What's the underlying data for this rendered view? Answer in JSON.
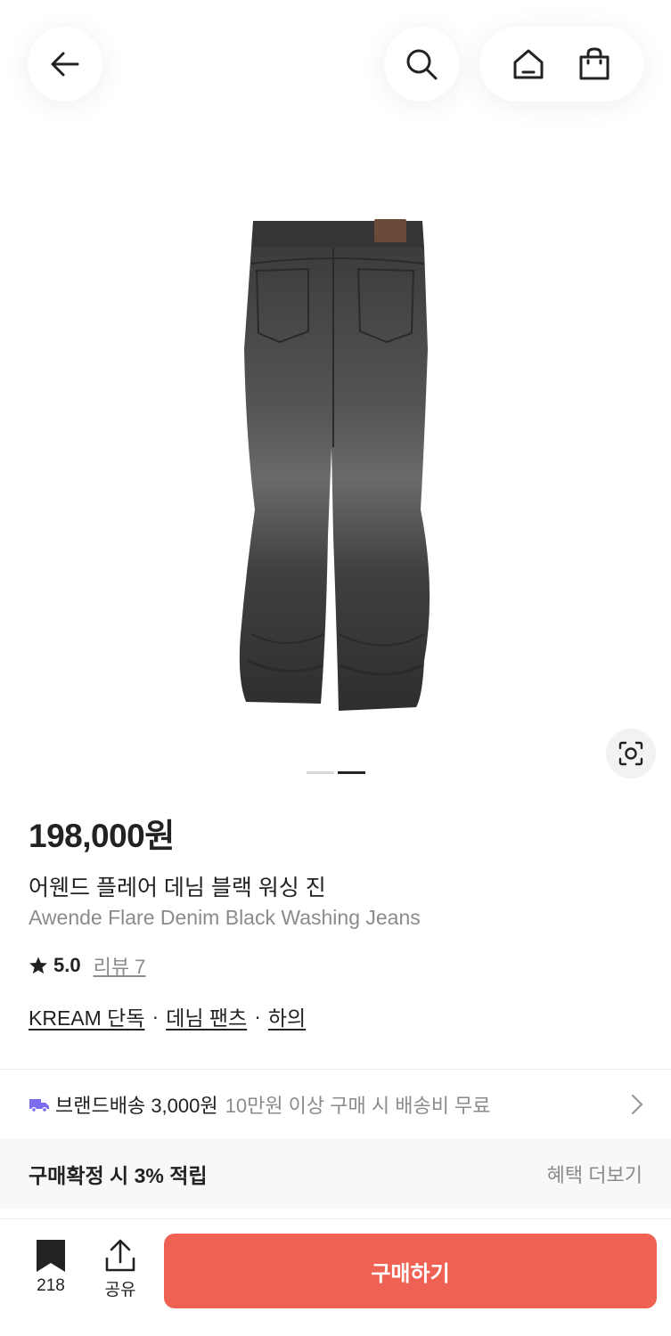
{
  "header": {
    "back_icon": "arrow-left-icon",
    "search_icon": "search-icon",
    "home_icon": "home-icon",
    "cart_icon": "shopping-bag-icon"
  },
  "gallery": {
    "image_icon": "jeans-product-image",
    "lens_icon": "lens-search-icon",
    "page_count": 2,
    "active_page": 2
  },
  "product": {
    "price": "198,000원",
    "name_ko": "어웬드 플레어 데님 블랙 워싱 진",
    "name_en": "Awende Flare Denim Black Washing Jeans",
    "rating": "5.0",
    "review_label": "리뷰 7",
    "tags": [
      "KREAM 단독",
      "데님 팬츠",
      "하의"
    ],
    "tag_separator": "·"
  },
  "shipping": {
    "label": "브랜드배송 3,000원",
    "note": "10만원 이상 구매 시 배송비 무료",
    "icon_color": "#7b6cf0"
  },
  "benefit": {
    "label": "구매확정 시 3% 적립",
    "more": "혜택 더보기"
  },
  "bottom": {
    "bookmark_count": "218",
    "share_label": "공유",
    "buy_label": "구매하기",
    "buy_color": "#ef6253"
  }
}
